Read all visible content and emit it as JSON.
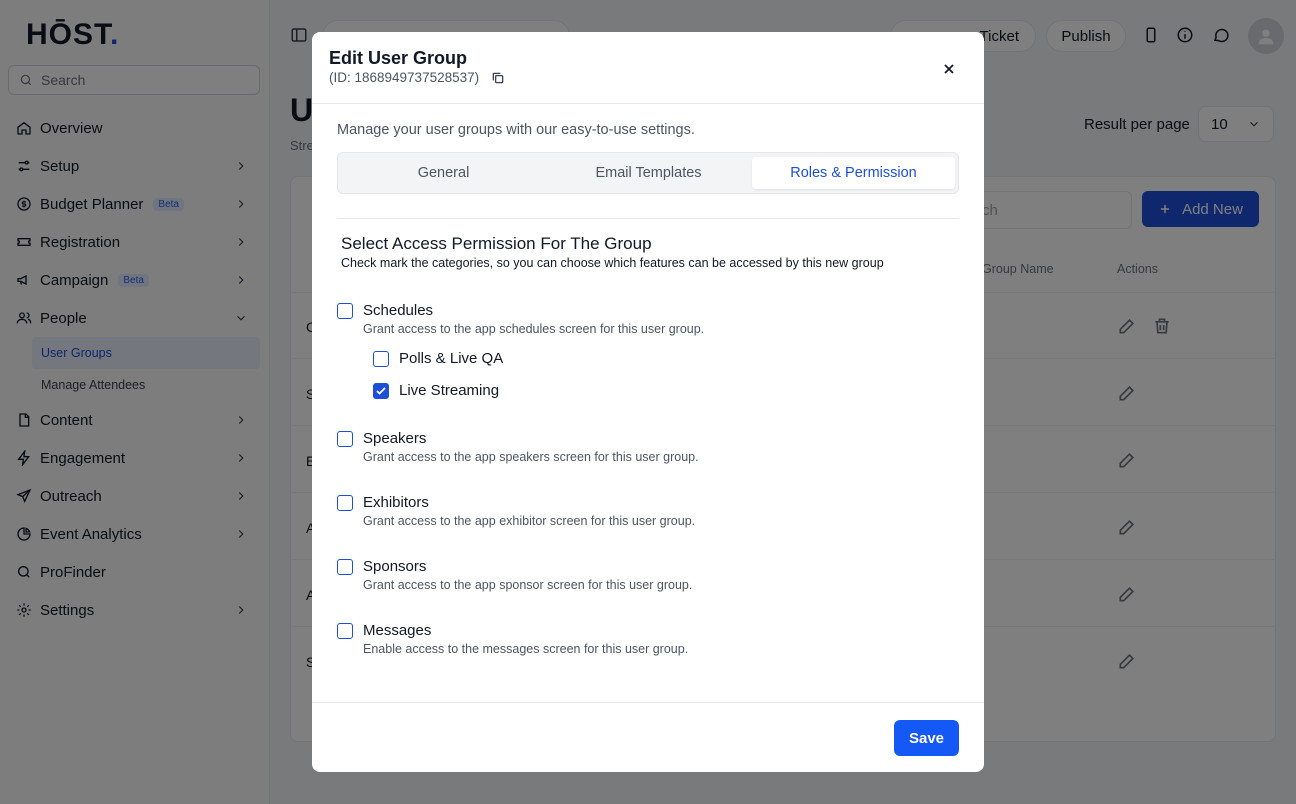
{
  "app": {
    "logo_text": "HŌST",
    "logo_dot": ".",
    "search_placeholder": "Search"
  },
  "sidebar": {
    "items": [
      {
        "label": "Overview",
        "icon": "home-icon"
      },
      {
        "label": "Setup",
        "icon": "settings-sliders-icon"
      },
      {
        "label": "Budget Planner",
        "icon": "dollar-icon",
        "badge": "Beta"
      },
      {
        "label": "Registration",
        "icon": "ticket-icon"
      },
      {
        "label": "Campaign",
        "icon": "megaphone-icon",
        "badge": "Beta"
      },
      {
        "label": "People",
        "icon": "people-icon"
      },
      {
        "label": "Content",
        "icon": "document-icon"
      },
      {
        "label": "Engagement",
        "icon": "lightning-icon"
      },
      {
        "label": "Outreach",
        "icon": "send-icon"
      },
      {
        "label": "Event Analytics",
        "icon": "pie-chart-icon"
      },
      {
        "label": "ProFinder",
        "icon": "search-icon"
      },
      {
        "label": "Settings",
        "icon": "gear-icon"
      }
    ],
    "people_sub": [
      "User Groups",
      "Manage Attendees"
    ]
  },
  "topbar": {
    "ticket_label": "Ticket",
    "publish_label": "Publish"
  },
  "page": {
    "title_initial": "U",
    "subtitle_initial": "Stre",
    "result_per_page_label": "Result per page",
    "result_per_page_value": "10",
    "search_placeholder": "rch",
    "add_new_label": "Add New",
    "col_group_name": "Group Name",
    "col_actions": "Actions",
    "row_initials": [
      "C",
      "S",
      "E",
      "A",
      "A",
      "S"
    ]
  },
  "modal": {
    "title": "Edit User Group",
    "id_text": "(ID: 1868949737528537)",
    "description": "Manage your user groups with our easy-to-use settings.",
    "tabs": [
      {
        "label": "General",
        "active": false
      },
      {
        "label": "Email Templates",
        "active": false
      },
      {
        "label": "Roles & Permission",
        "active": true
      }
    ],
    "section_title": "Select Access Permission For The Group",
    "section_subtitle": "Check mark the categories, so you can choose which features can be accessed by this new group",
    "permissions": [
      {
        "label": "Schedules",
        "desc": "Grant access to the app schedules screen for this user group.",
        "checked": false
      },
      {
        "label": "Polls & Live QA",
        "checked": false
      },
      {
        "label": "Live Streaming",
        "checked": true
      },
      {
        "label": "Speakers",
        "desc": "Grant access to the app speakers screen for this user group.",
        "checked": false
      },
      {
        "label": "Exhibitors",
        "desc": "Grant access to the app exhibitor screen for this user group.",
        "checked": false
      },
      {
        "label": "Sponsors",
        "desc": "Grant access to the app sponsor screen for this user group.",
        "checked": false
      },
      {
        "label": "Messages",
        "desc": "Enable access to the messages screen for this user group.",
        "checked": false
      }
    ],
    "save_label": "Save"
  },
  "colors": {
    "primary": "#1e4fd8",
    "save_button": "#1458f5",
    "overlay": "rgba(0,0,0,0.5)"
  }
}
